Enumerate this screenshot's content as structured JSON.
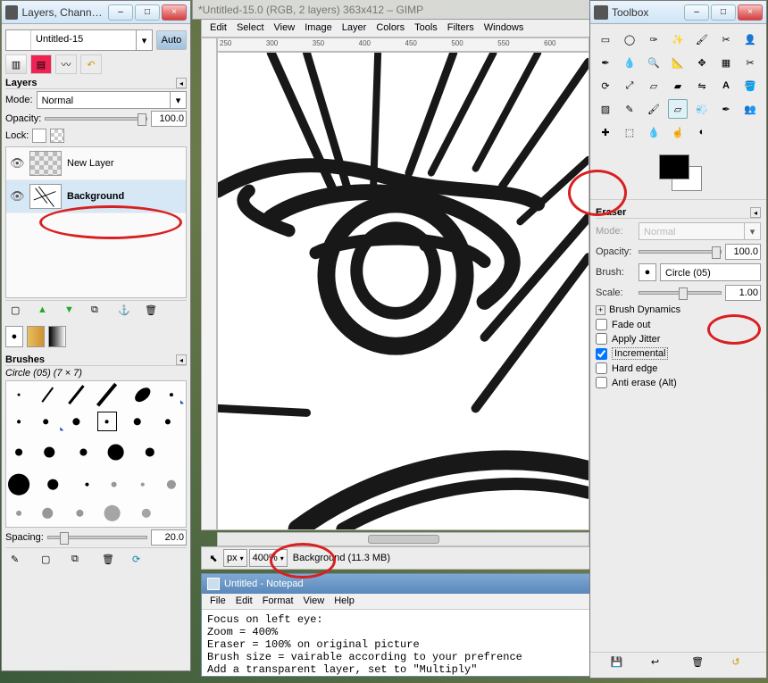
{
  "layers_window": {
    "title": "Layers, Channels,...",
    "image_select": "Untitled-15",
    "auto_button": "Auto",
    "section_title": "Layers",
    "mode_label": "Mode:",
    "mode_value": "Normal",
    "opacity_label": "Opacity:",
    "opacity_value": "100.0",
    "lock_label": "Lock:",
    "layers": [
      {
        "name": "New Layer"
      },
      {
        "name": "Background"
      }
    ],
    "brushes_section": "Brushes",
    "brush_name": "Circle (05) (7 × 7)",
    "spacing_label": "Spacing:",
    "spacing_value": "20.0"
  },
  "image_window": {
    "title": "*Untitled-15.0 (RGB, 2 layers) 363x412 – GIMP",
    "menus": [
      "Edit",
      "Select",
      "View",
      "Image",
      "Layer",
      "Colors",
      "Tools",
      "Filters",
      "Windows"
    ],
    "ruler_ticks": [
      "250",
      "300",
      "350",
      "400",
      "450",
      "500",
      "550",
      "600"
    ],
    "unit": "px",
    "zoom": "400%",
    "status": "Background (11.3 MB)"
  },
  "notepad": {
    "title": "Untitled - Notepad",
    "menus": [
      "File",
      "Edit",
      "Format",
      "View",
      "Help"
    ],
    "content": "Focus on left eye:\nZoom = 400%\nEraser = 100% on original picture\nBrush size = vairable according to your prefrence\nAdd a transparent layer, set to \"Multiply\""
  },
  "toolbox": {
    "title": "Toolbox",
    "tool_section": "Eraser",
    "mode_label": "Mode:",
    "mode_value": "Normal",
    "opacity_label": "Opacity:",
    "opacity_value": "100.0",
    "brush_label": "Brush:",
    "brush_value": "Circle (05)",
    "scale_label": "Scale:",
    "scale_value": "1.00",
    "brush_dynamics": "Brush Dynamics",
    "fade_out": "Fade out",
    "apply_jitter": "Apply Jitter",
    "incremental": "Incremental",
    "hard_edge": "Hard edge",
    "anti_erase": "Anti erase  (Alt)"
  }
}
